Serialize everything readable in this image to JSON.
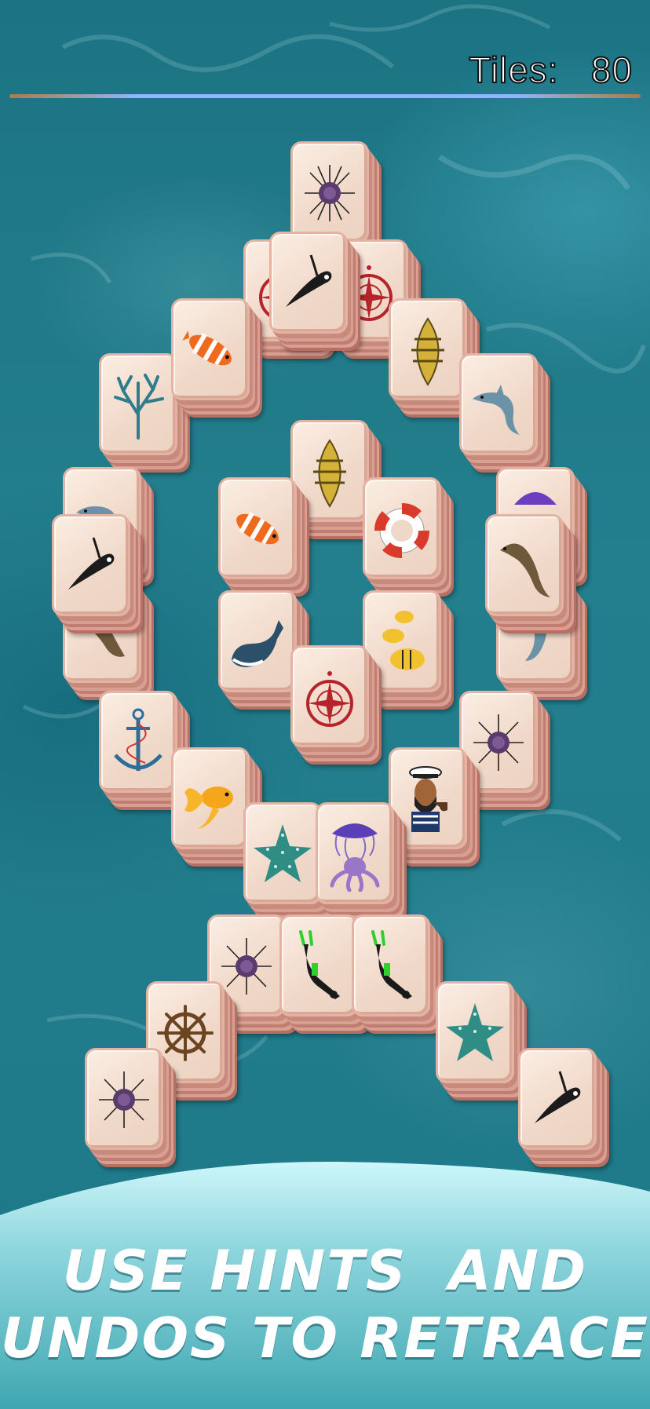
{
  "status": {
    "tiles_label": "Tiles:",
    "tiles_count": "80",
    "tiles_text": "Tiles:   80"
  },
  "promo": {
    "line1": "USE HINTS  AND",
    "line2": "UNDOS TO RETRACE"
  },
  "colors": {
    "ocean": "#1f7f8c",
    "tile_face": "#f4e1d4",
    "tile_edge": "#c98a7e",
    "wave": "#c9f2f6"
  },
  "tile_faces": [
    "urchin",
    "manta",
    "compass",
    "compass",
    "clownfish",
    "boat",
    "coral",
    "dolphin",
    "dolphin",
    "jellyfish",
    "manta",
    "boat",
    "clownfish",
    "lifebuoy",
    "seal",
    "seal",
    "whale",
    "yellowfish",
    "dolphin",
    "compass",
    "anchor",
    "urchin",
    "goldfish",
    "sailor",
    "starfish",
    "octopus",
    "urchin",
    "diver",
    "diver",
    "wheel",
    "starfish",
    "urchin",
    "manta"
  ]
}
